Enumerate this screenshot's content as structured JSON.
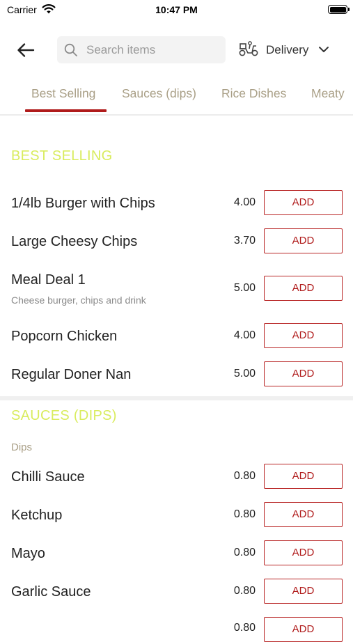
{
  "status_bar": {
    "carrier": "Carrier",
    "time": "10:47 PM"
  },
  "header": {
    "search_placeholder": "Search items",
    "delivery_label": "Delivery"
  },
  "tabs": [
    "Best Selling",
    "Sauces (dips)",
    "Rice Dishes",
    "Meaty"
  ],
  "active_tab": 0,
  "sections": [
    {
      "title": "BEST SELLING",
      "items": [
        {
          "name": "1/4lb Burger with Chips",
          "price": "4.00",
          "button": "ADD"
        },
        {
          "name": "Large Cheesy Chips",
          "price": "3.70",
          "button": "ADD"
        },
        {
          "name": "Meal Deal 1",
          "description": "Cheese burger, chips and drink",
          "price": "5.00",
          "button": "ADD"
        },
        {
          "name": "Popcorn Chicken",
          "price": "4.00",
          "button": "ADD"
        },
        {
          "name": "Regular Doner Nan",
          "price": "5.00",
          "button": "ADD"
        }
      ]
    },
    {
      "title": "SAUCES (DIPS)",
      "subtitle": "Dips",
      "items": [
        {
          "name": "Chilli Sauce",
          "price": "0.80",
          "button": "ADD"
        },
        {
          "name": "Ketchup",
          "price": "0.80",
          "button": "ADD"
        },
        {
          "name": "Mayo",
          "price": "0.80",
          "button": "ADD"
        },
        {
          "name": "Garlic Sauce",
          "price": "0.80",
          "button": "ADD"
        },
        {
          "name": "",
          "price": "0.80",
          "button": "ADD"
        }
      ]
    }
  ],
  "colors": {
    "accent": "#b01b1b",
    "section_title": "#d9ec5e",
    "tab_text": "#a99f86"
  },
  "icons": [
    "wifi-icon",
    "battery-icon",
    "back-arrow-icon",
    "search-icon",
    "scooter-icon",
    "chevron-down-icon"
  ]
}
